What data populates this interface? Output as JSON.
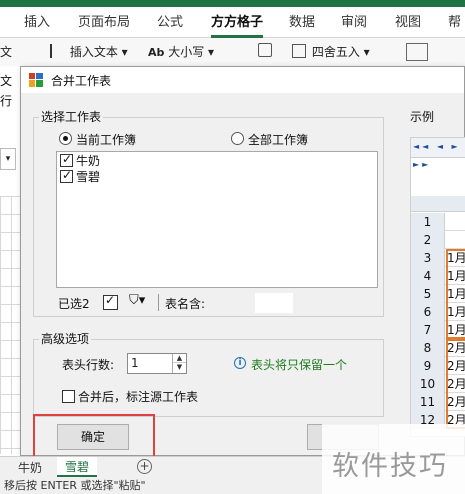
{
  "ribbon": {
    "tabs": [
      "插入",
      "页面布局",
      "公式",
      "方方格子",
      "数据",
      "审阅",
      "视图",
      "帮"
    ],
    "active_tab": "方方格子",
    "items": {
      "left_1": "文",
      "insert_text": "插入文本",
      "case_label": "大小写",
      "round_label": "四舍五入"
    },
    "left_col": [
      "文",
      "文",
      "行"
    ]
  },
  "dialog": {
    "title": "合并工作表",
    "choose_group_label": "选择工作表",
    "radio_current": "当前工作簿",
    "radio_all": "全部工作簿",
    "sheets": [
      {
        "name": "牛奶",
        "checked": true
      },
      {
        "name": "雪碧",
        "checked": true
      }
    ],
    "selected_count": "已选2",
    "sheet_name_label": "表名含:",
    "sheet_name_value": "",
    "advanced_label": "高级选项",
    "header_rows_label": "表头行数:",
    "header_rows_value": "1",
    "info_text": "表头将只保留一个",
    "mark_source_label": "合并后，标注源工作表",
    "mark_source_checked": false,
    "ok_label": "确定",
    "preview_label": "示例",
    "preview_nav": "◄◄ ◄ ► ►►",
    "preview_rows": [
      {
        "num": "1",
        "cell": ""
      },
      {
        "num": "2",
        "cell": ""
      },
      {
        "num": "3",
        "cell": "1月"
      },
      {
        "num": "4",
        "cell": "1月"
      },
      {
        "num": "5",
        "cell": "1月"
      },
      {
        "num": "6",
        "cell": "1月"
      },
      {
        "num": "7",
        "cell": "1月"
      },
      {
        "num": "8",
        "cell": "2月"
      },
      {
        "num": "9",
        "cell": "2月"
      },
      {
        "num": "10",
        "cell": "2月"
      },
      {
        "num": "11",
        "cell": "2月"
      },
      {
        "num": "12",
        "cell": "2月"
      }
    ]
  },
  "sheet_tabs": [
    "牛奶",
    "雪碧"
  ],
  "active_sheet": "雪碧",
  "status_text": "移后按 ENTER 或选择\"粘贴\"",
  "watermark": "软件技巧",
  "colors": {
    "accent": "#217346",
    "highlight": "#e04040",
    "preview_border": "#e07a2e",
    "info_text": "#1e7a1e"
  }
}
